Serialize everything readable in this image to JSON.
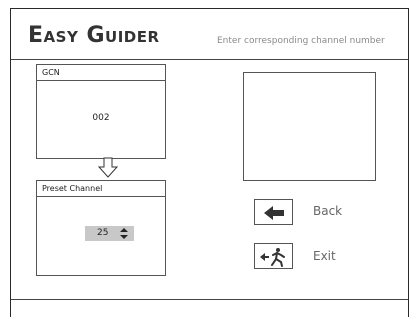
{
  "header": {
    "logo": "Easy Guider",
    "hint": "Enter corresponding channel number"
  },
  "gcn_panel": {
    "title": "GCN",
    "value": "002"
  },
  "preset_panel": {
    "title": "Preset Channel",
    "value": "25"
  },
  "actions": {
    "back_label": "Back",
    "exit_label": "Exit"
  },
  "icons": {
    "down_arrow": "arrow-down-icon",
    "spinner": "up-down-spinner-icon",
    "back": "arrow-left-icon",
    "exit": "exit-running-man-icon"
  },
  "colors": {
    "border": "#555555",
    "spinner_bg": "#c8c8c8",
    "hint_text": "#8a8a8a",
    "label_text": "#666666"
  }
}
